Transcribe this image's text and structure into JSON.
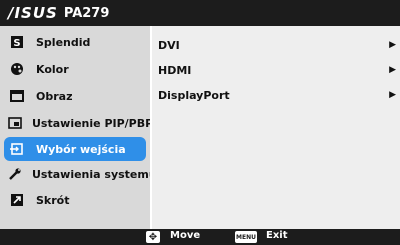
{
  "header": {
    "brand": "/ISUS",
    "model": "PA279"
  },
  "sidebar": {
    "items": [
      {
        "label": "Splendid",
        "icon": "splendid-icon"
      },
      {
        "label": "Kolor",
        "icon": "color-palette-icon"
      },
      {
        "label": "Obraz",
        "icon": "image-icon"
      },
      {
        "label": "Ustawienie PIP/PBP",
        "icon": "pip-icon"
      },
      {
        "label": "Wybór wejścia",
        "icon": "input-select-icon",
        "selected": true
      },
      {
        "label": "Ustawienia systemu",
        "icon": "wrench-icon"
      },
      {
        "label": "Skrót",
        "icon": "shortcut-icon"
      }
    ]
  },
  "main": {
    "options": [
      {
        "label": "DVI",
        "arrow": "▶"
      },
      {
        "label": "HDMI",
        "arrow": "▶"
      },
      {
        "label": "DisplayPort",
        "arrow": "▶"
      }
    ]
  },
  "footer": {
    "move_key": "✥",
    "move_label": "Move",
    "menu_key": "MENU",
    "exit_label": "Exit"
  },
  "colors": {
    "selected": "#2f8fe8",
    "sidebar_bg": "#d9d9d9",
    "bar_bg": "#1c1c1c"
  }
}
